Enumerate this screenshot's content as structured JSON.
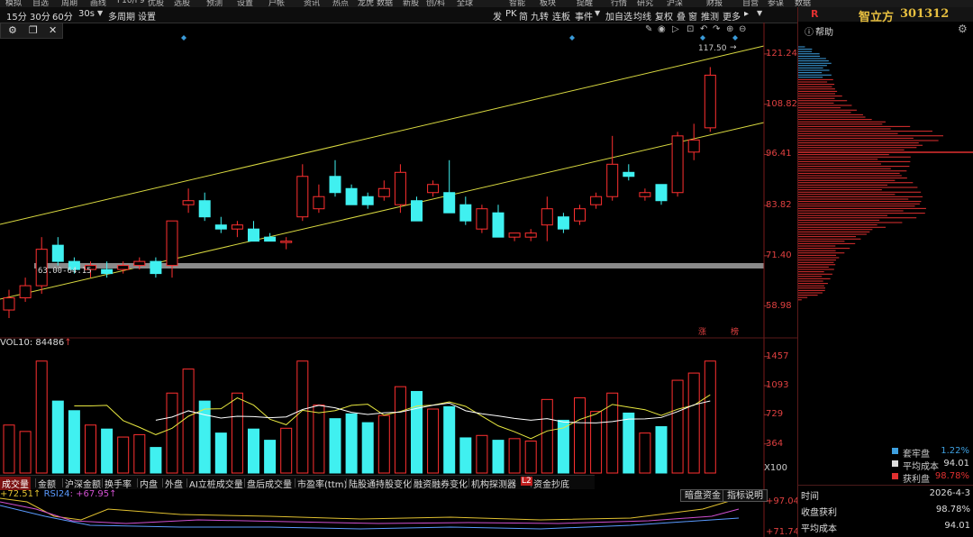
{
  "topmenu": [
    "模拟",
    "自选",
    "周期",
    "画线",
    "F10/F9",
    "优股",
    "选股",
    "预测",
    "设置",
    "户帐",
    "资讯",
    "热点",
    "龙虎",
    "数据",
    "新股",
    "创/科",
    "全球",
    "智能",
    "板块",
    "提醒",
    "行情",
    "研究",
    "沪深",
    "财报",
    "自营",
    "参谋",
    "数据",
    "热股"
  ],
  "toolbar": {
    "periods": [
      "15分",
      "30分",
      "60分",
      "30s"
    ],
    "multi_period": "多周期",
    "settings": "设置",
    "right_items": [
      "发",
      "PK",
      "简",
      "九转",
      "连板",
      "事件",
      "加自选",
      "均线",
      "复权",
      "叠",
      "窗",
      "推测",
      "更多"
    ]
  },
  "stock": {
    "code_label": "R",
    "name": "智立方",
    "code": "301312",
    "help": "帮助"
  },
  "price_axis": [
    "121.24",
    "108.82",
    "96.41",
    "83.82",
    "71.40",
    "58.98"
  ],
  "price_range": {
    "max": 125,
    "min": 52
  },
  "annotations": {
    "high_label": "117.50",
    "range_label": "63.00-64.15",
    "mark1": "涨",
    "mark2": "榜"
  },
  "vol": {
    "label": "VOL10: 84486",
    "arrow": "↑",
    "axis": [
      "1457",
      "1093",
      "729",
      "364"
    ],
    "unit": "X100",
    "max": 1600
  },
  "chart_data": {
    "type": "candlestick",
    "candles": [
      [
        58,
        61,
        56,
        63,
        600
      ],
      [
        61,
        64,
        60,
        66,
        520
      ],
      [
        64,
        73,
        62,
        76,
        1400
      ],
      [
        74,
        70,
        69,
        76,
        900
      ],
      [
        70,
        68,
        67,
        71,
        780
      ],
      [
        68,
        69,
        66,
        70,
        600
      ],
      [
        68,
        67,
        66,
        70,
        550
      ],
      [
        68,
        69,
        67,
        70,
        450
      ],
      [
        69,
        70,
        68,
        71,
        480
      ],
      [
        70,
        67,
        66,
        71,
        320
      ],
      [
        69,
        80,
        66,
        80,
        1000
      ],
      [
        84,
        85,
        82,
        88,
        1300
      ],
      [
        85,
        81,
        80,
        87,
        900
      ],
      [
        79,
        78,
        77,
        81,
        500
      ],
      [
        78,
        79,
        76,
        80,
        1000
      ],
      [
        78,
        75,
        75,
        80,
        550
      ],
      [
        76,
        75,
        75,
        77,
        410
      ],
      [
        75,
        75,
        73,
        76,
        560
      ],
      [
        81,
        91,
        80,
        94,
        1400
      ],
      [
        83,
        86,
        82,
        89,
        850
      ],
      [
        91,
        87,
        86,
        95,
        680
      ],
      [
        88,
        84,
        84,
        89,
        740
      ],
      [
        86,
        84,
        83,
        87,
        630
      ],
      [
        86,
        88,
        85,
        90,
        720
      ],
      [
        84,
        92,
        82,
        94,
        1080
      ],
      [
        85,
        80,
        80,
        86,
        1020
      ],
      [
        87,
        89,
        86,
        90,
        800
      ],
      [
        87,
        82,
        82,
        95,
        830
      ],
      [
        84,
        80,
        79,
        86,
        440
      ],
      [
        78,
        83,
        77,
        84,
        470
      ],
      [
        82,
        76,
        76,
        84,
        410
      ],
      [
        76,
        77,
        75,
        77,
        430
      ],
      [
        76,
        77,
        75,
        78,
        400
      ],
      [
        79,
        83,
        75,
        86,
        920
      ],
      [
        81,
        78,
        77,
        82,
        660
      ],
      [
        80,
        83,
        79,
        84,
        940
      ],
      [
        84,
        86,
        83,
        87,
        770
      ],
      [
        86,
        94,
        85,
        101,
        1000
      ],
      [
        92,
        91,
        90,
        94,
        750
      ],
      [
        86,
        87,
        85,
        88,
        500
      ],
      [
        89,
        85,
        84,
        89,
        580
      ],
      [
        87,
        101,
        86,
        102,
        1160
      ],
      [
        97,
        100,
        95,
        104,
        1250
      ],
      [
        103,
        116,
        102,
        118,
        1400
      ]
    ],
    "price_axis": [
      121.24,
      108.82,
      96.41,
      83.82,
      71.4,
      58.98
    ],
    "vol_axis": [
      1457,
      1093,
      729,
      364
    ]
  },
  "bottom_tabs": {
    "items": [
      "成交量",
      "金额",
      "沪深金额",
      "换手率",
      "内盘",
      "外盘",
      "AI立桩成交量",
      "盘后成交量",
      "市盈率(ttm)",
      "陆股通持股变化",
      "融资融券变化",
      "机构探测器",
      "资金抄底"
    ],
    "badge": "L2",
    "btn1": "暗盘资金",
    "btn2": "指标说明"
  },
  "rsi": {
    "v1": "+72.51↑",
    "label": "RSI24",
    "v2": ": +67.95↑",
    "axis1": "+97.04",
    "axis2": "+71.74"
  },
  "legend": [
    {
      "name": "套牢盘",
      "value": "1.22%",
      "color": "#3ea0e0"
    },
    {
      "name": "平均成本",
      "value": "94.01",
      "color": "#dddddd"
    },
    {
      "name": "获利盘",
      "value": "98.78%",
      "color": "#e03030"
    }
  ],
  "info": [
    {
      "label": "时间",
      "value": "2026-4-3"
    },
    {
      "label": "收盘获利",
      "value": "98.78%"
    },
    {
      "label": "平均成本",
      "value": "94.01"
    }
  ]
}
